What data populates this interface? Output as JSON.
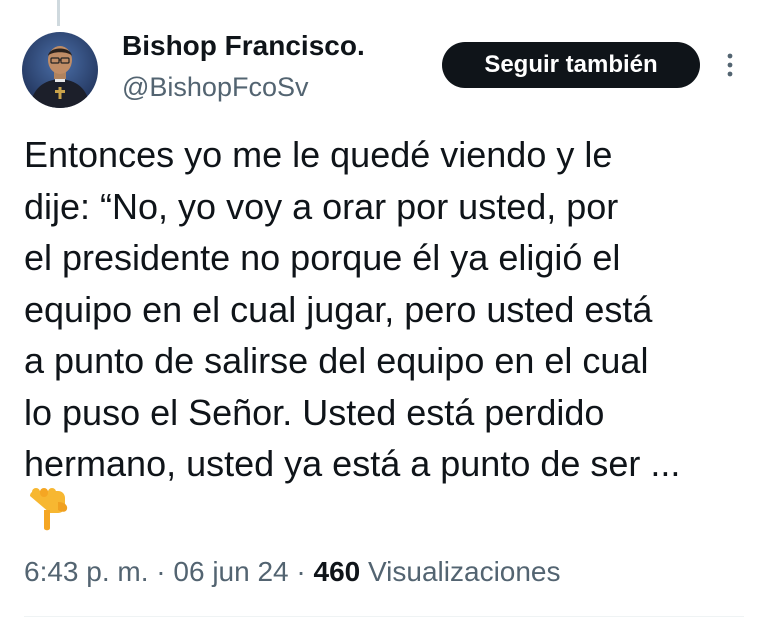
{
  "author": {
    "name": "Bishop Francisco.",
    "handle": "@BishopFcoSv",
    "avatar_icon": "profile-photo"
  },
  "follow_button": {
    "label": "Seguir también"
  },
  "more_menu": {
    "icon": "more-vertical-icon"
  },
  "tweet": {
    "lines": [
      "Entonces yo me le quedé viendo y le",
      "dije: “No, yo voy a orar por usted, por",
      "el presidente no porque él ya eligió el",
      "equipo en el cual jugar, pero usted está",
      "a punto de salirse del equipo en el cual",
      "lo puso el Señor. Usted está perdido",
      "hermano, usted ya está a punto de ser ..."
    ],
    "emoji": "backhand-index-pointing-down-emoji"
  },
  "meta": {
    "time": "6:43 p. m.",
    "separator": " · ",
    "date": "06 jun 24",
    "views_count": "460",
    "views_label": "Visualizaciones"
  },
  "colors": {
    "text_primary": "#0f1419",
    "text_secondary": "#536471",
    "button_bg": "#0f1419",
    "button_text": "#ffffff",
    "thread_line": "#cfd9de"
  }
}
